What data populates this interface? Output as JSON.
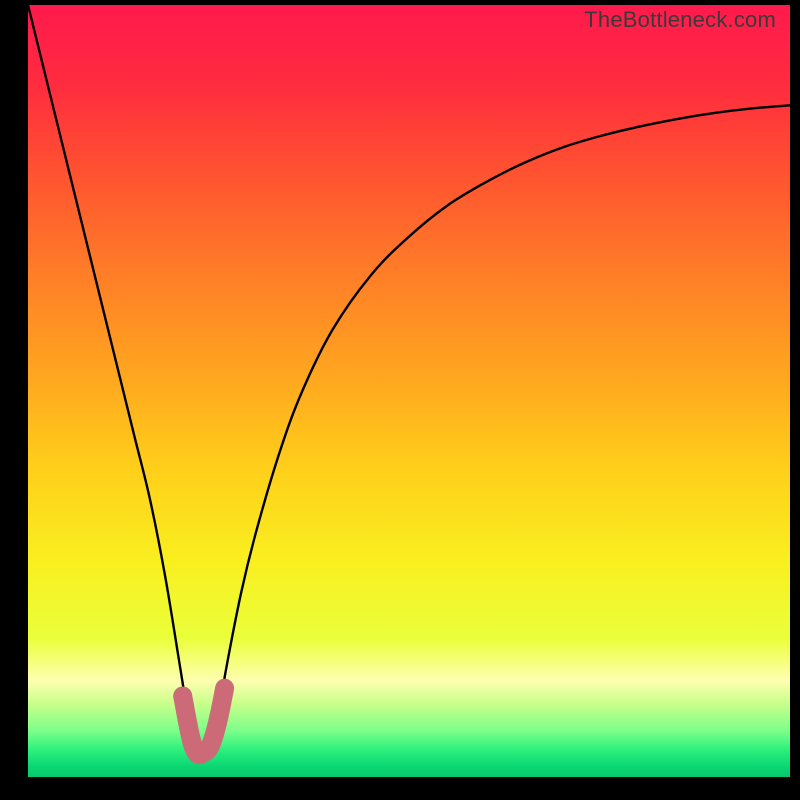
{
  "watermark": "TheBottleneck.com",
  "chart_data": {
    "type": "line",
    "title": "",
    "xlabel": "",
    "ylabel": "",
    "xlim": [
      0,
      100
    ],
    "ylim": [
      0,
      100
    ],
    "grid": false,
    "legend": false,
    "annotations": [],
    "series": [
      {
        "name": "bottleneck-curve",
        "color": "#000000",
        "x": [
          0,
          2,
          4,
          6,
          8,
          10,
          12,
          14,
          16,
          18,
          20,
          21,
          22,
          23,
          24,
          25,
          26,
          28,
          30,
          33,
          36,
          40,
          45,
          50,
          55,
          60,
          65,
          70,
          75,
          80,
          85,
          90,
          95,
          100
        ],
        "y": [
          100,
          92,
          84,
          76,
          68,
          60,
          52,
          44,
          36,
          26,
          14,
          8,
          4,
          3,
          4,
          8,
          14,
          24,
          32,
          42,
          50,
          58,
          65,
          70,
          74,
          77,
          79.5,
          81.5,
          83,
          84.2,
          85.2,
          86,
          86.6,
          87
        ]
      },
      {
        "name": "highlight-valley",
        "color": "#cc6b77",
        "x": [
          20.3,
          21.0,
          21.6,
          22.2,
          22.8,
          23.1,
          23.1,
          23.5,
          24.0,
          24.6,
          25.2,
          25.8
        ],
        "y": [
          10.5,
          6.8,
          4.2,
          3.0,
          3.0,
          3.3,
          3.3,
          3.4,
          4.2,
          6.0,
          8.5,
          11.5
        ]
      }
    ],
    "background_gradient": {
      "type": "vertical",
      "stops": [
        {
          "pos": 0.0,
          "color": "#ff1a4d"
        },
        {
          "pos": 0.1,
          "color": "#ff2b3f"
        },
        {
          "pos": 0.22,
          "color": "#ff5330"
        },
        {
          "pos": 0.35,
          "color": "#ff7e27"
        },
        {
          "pos": 0.48,
          "color": "#ffa61f"
        },
        {
          "pos": 0.6,
          "color": "#ffcf1a"
        },
        {
          "pos": 0.72,
          "color": "#f9ef1f"
        },
        {
          "pos": 0.82,
          "color": "#eaff3a"
        },
        {
          "pos": 0.875,
          "color": "#ffffb0"
        },
        {
          "pos": 0.905,
          "color": "#c8ff8a"
        },
        {
          "pos": 0.94,
          "color": "#7cff8a"
        },
        {
          "pos": 0.965,
          "color": "#2cf07c"
        },
        {
          "pos": 0.985,
          "color": "#0cd874"
        },
        {
          "pos": 1.0,
          "color": "#07c96c"
        }
      ]
    }
  }
}
